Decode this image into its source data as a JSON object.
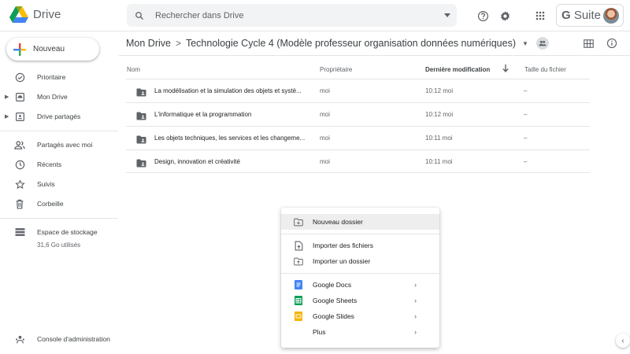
{
  "header": {
    "app_name": "Drive",
    "search_placeholder": "Rechercher dans Drive",
    "gsuite_label_g": "G",
    "gsuite_label_rest": " Suite"
  },
  "sidebar": {
    "new_label": "Nouveau",
    "items": [
      {
        "label": "Prioritaire",
        "icon": "check-circle-icon"
      },
      {
        "label": "Mon Drive",
        "icon": "drive-icon"
      },
      {
        "label": "Drive partagés",
        "icon": "shared-drive-icon"
      },
      {
        "label": "Partagés avec moi",
        "icon": "people-icon"
      },
      {
        "label": "Récents",
        "icon": "clock-icon"
      },
      {
        "label": "Suivis",
        "icon": "star-icon"
      },
      {
        "label": "Corbeille",
        "icon": "trash-icon"
      }
    ],
    "storage_label": "Espace de stockage",
    "storage_used": "31,6 Go utilisés",
    "admin_label": "Console d'administration"
  },
  "breadcrumb": {
    "root": "Mon Drive",
    "separator": ">",
    "current": "Technologie Cycle 4 (Modèle professeur organisation données numériques)"
  },
  "table": {
    "columns": {
      "name": "Nom",
      "owner": "Propriétaire",
      "modified": "Dernière modification",
      "size": "Taille du fichier"
    },
    "rows": [
      {
        "name": "La modélisation et la simulation des objets et systè...",
        "owner": "moi",
        "modified": "10:12 moi",
        "size": "–"
      },
      {
        "name": "L'informatique et la programmation",
        "owner": "moi",
        "modified": "10:12 moi",
        "size": "–"
      },
      {
        "name": "Les objets techniques, les services et les changeme...",
        "owner": "moi",
        "modified": "10:11 moi",
        "size": "–"
      },
      {
        "name": "Design, innovation et créativité",
        "owner": "moi",
        "modified": "10:11 moi",
        "size": "–"
      }
    ]
  },
  "menu": {
    "new_folder": "Nouveau dossier",
    "import_files": "Importer des fichiers",
    "import_folder": "Importer un dossier",
    "google_docs": "Google Docs",
    "google_sheets": "Google Sheets",
    "google_slides": "Google Slides",
    "more": "Plus"
  },
  "colors": {
    "docs": "#4285f4",
    "sheets": "#0f9d58",
    "slides": "#f4b400",
    "icon_gray": "#5f6368"
  }
}
